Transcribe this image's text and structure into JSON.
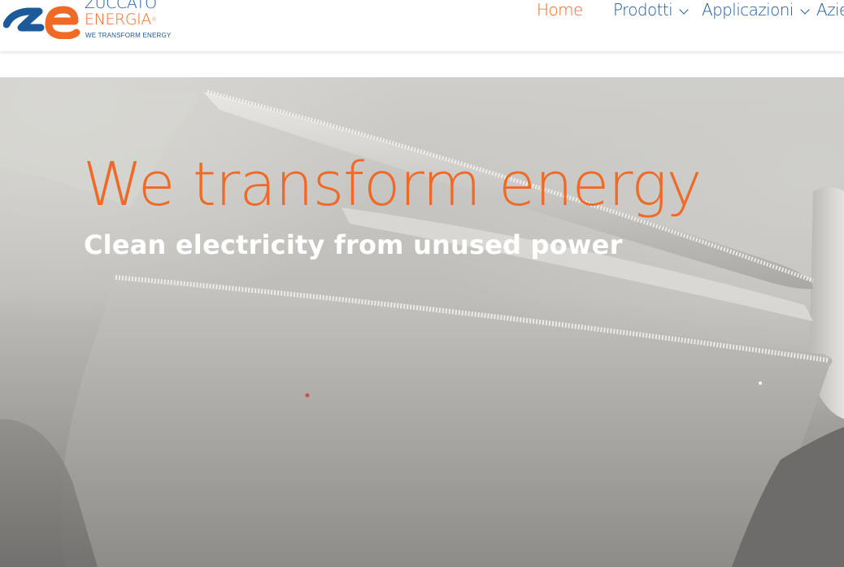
{
  "brand": {
    "name_line1": "ZUCCATO",
    "name_line2": "ENERGIA",
    "registered": "®",
    "tagline": "WE TRANSFORM ENERGY",
    "colors": {
      "blue": "#1d5a9a",
      "orange": "#ef6a26"
    }
  },
  "nav": {
    "items": [
      {
        "label": "Home",
        "active": true
      },
      {
        "label": "Prodotti",
        "has_dropdown": true
      },
      {
        "label": "Applicazioni",
        "has_dropdown": true
      },
      {
        "label": "Azie",
        "has_dropdown": false
      }
    ],
    "icons": [
      "chevron-down-icon"
    ]
  },
  "hero": {
    "title": "We transform energy",
    "subtitle": "Clean electricity from unused power",
    "background": "turbine-blades-photo"
  }
}
